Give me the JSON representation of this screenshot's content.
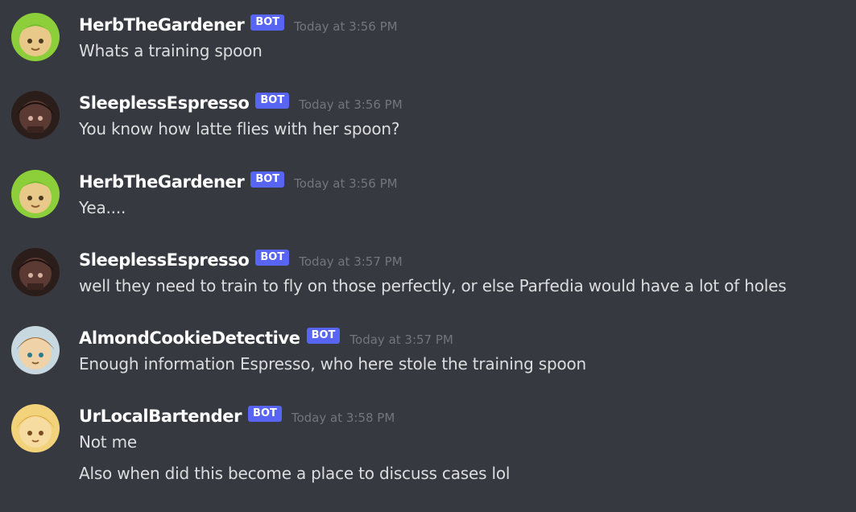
{
  "badge_label": "BOT",
  "messages": [
    {
      "username": "HerbTheGardener",
      "timestamp": "Today at 3:56 PM",
      "avatar": "herb-avatar-icon",
      "lines": [
        "Whats a training spoon"
      ]
    },
    {
      "username": "SleeplessEspresso",
      "timestamp": "Today at 3:56 PM",
      "avatar": "espresso-avatar-icon",
      "lines": [
        "You know how latte flies with her spoon?"
      ]
    },
    {
      "username": "HerbTheGardener",
      "timestamp": "Today at 3:56 PM",
      "avatar": "herb-avatar-icon",
      "lines": [
        "Yea...."
      ]
    },
    {
      "username": "SleeplessEspresso",
      "timestamp": "Today at 3:57 PM",
      "avatar": "espresso-avatar-icon",
      "lines": [
        "well they need to train to fly on those perfectly, or else Parfedia would have a lot of holes"
      ]
    },
    {
      "username": "AlmondCookieDetective",
      "timestamp": "Today at 3:57 PM",
      "avatar": "almond-avatar-icon",
      "lines": [
        "Enough information Espresso, who here stole the training spoon"
      ]
    },
    {
      "username": "UrLocalBartender",
      "timestamp": "Today at 3:58 PM",
      "avatar": "bartender-avatar-icon",
      "lines": [
        "Not me",
        "Also when did this become a place to discuss cases lol"
      ]
    }
  ]
}
